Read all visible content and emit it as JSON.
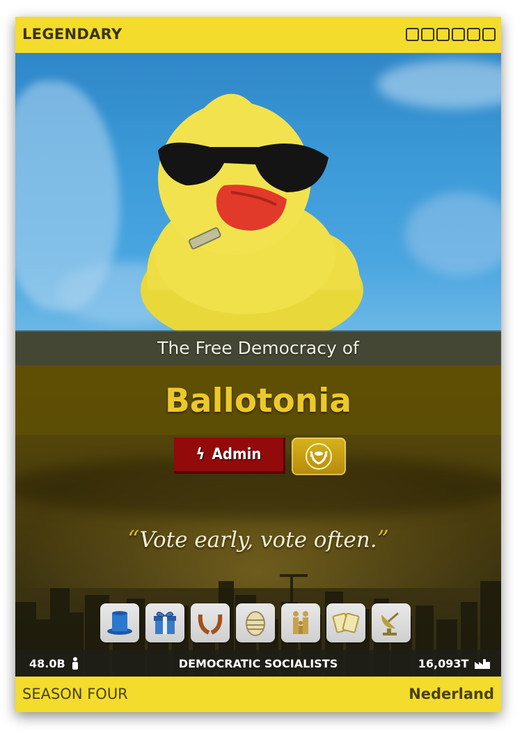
{
  "card": {
    "rarity": "LEGENDARY",
    "collection_slots": 6,
    "pretitle": "The Free Democracy of",
    "nation_name": "Ballotonia",
    "admin_badge_label": "Admin",
    "motto": "Vote early, vote often.",
    "badges": [
      "top-hat-icon",
      "gift-icon",
      "laurel-icon",
      "easter-egg-icon",
      "family-icon",
      "cards-icon",
      "satellite-dish-icon"
    ],
    "population": "48.0B",
    "category": "DEMOCRATIC SOCIALISTS",
    "industry": "16,093T",
    "season": "SEASON FOUR",
    "region": "Nederland"
  },
  "colors": {
    "frame_yellow": "#f3dc2c",
    "name_gold": "#ecc92a",
    "admin_red": "#920a0a"
  }
}
